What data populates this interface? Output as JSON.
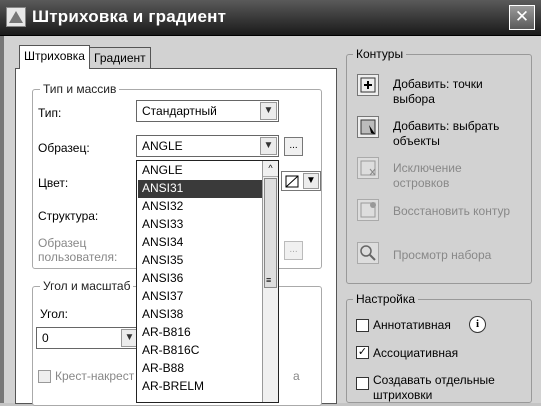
{
  "window": {
    "title": "Штриховка и градиент",
    "close_glyph": "✕"
  },
  "tabs": [
    {
      "label": "Штриховка",
      "active": true
    },
    {
      "label": "Градиент",
      "active": false
    }
  ],
  "type_pattern_group": {
    "title": "Тип и массив",
    "type_label": "Тип:",
    "type_value": "Стандартный",
    "pattern_label": "Образец:",
    "pattern_value": "ANGLE",
    "color_label": "Цвет:",
    "structure_label": "Структура:",
    "custom_pattern_label_line1": "Образец",
    "custom_pattern_label_line2": "пользователя:",
    "browse_button": "..."
  },
  "angle_scale_group": {
    "title": "Угол и масштаб",
    "angle_label": "Угол:",
    "angle_value": "0",
    "crosshatch_label": "Крест-накрест",
    "relative_label": "а"
  },
  "pattern_dropdown": {
    "items": [
      "ANGLE",
      "ANSI31",
      "ANSI32",
      "ANSI33",
      "ANSI34",
      "ANSI35",
      "ANSI36",
      "ANSI37",
      "ANSI38",
      "AR-B816",
      "AR-B816C",
      "AR-B88",
      "AR-BRELM"
    ],
    "selected": "ANSI31",
    "scroll_up": "^",
    "grip": "≡"
  },
  "contours_group": {
    "title": "Контуры",
    "add_points_line1": "Добавить: точки",
    "add_points_line2": "выбора",
    "add_objects_line1": "Добавить: выбрать",
    "add_objects_line2": "объекты",
    "remove_islands_line1": "Исключение",
    "remove_islands_line2": "островков",
    "recreate_boundary": "Восстановить контур",
    "view_selection": "Просмотр набора"
  },
  "options_group": {
    "title": "Настройка",
    "annotative_label": "Аннотативная",
    "annotative_checked": false,
    "associative_label": "Ассоциативная",
    "associative_checked": true,
    "separate_line1": "Создавать отдельные",
    "separate_line2": "штриховки",
    "separate_checked": false,
    "check_glyph": "✓",
    "info_glyph": "i"
  },
  "arrow_glyph": "▼"
}
